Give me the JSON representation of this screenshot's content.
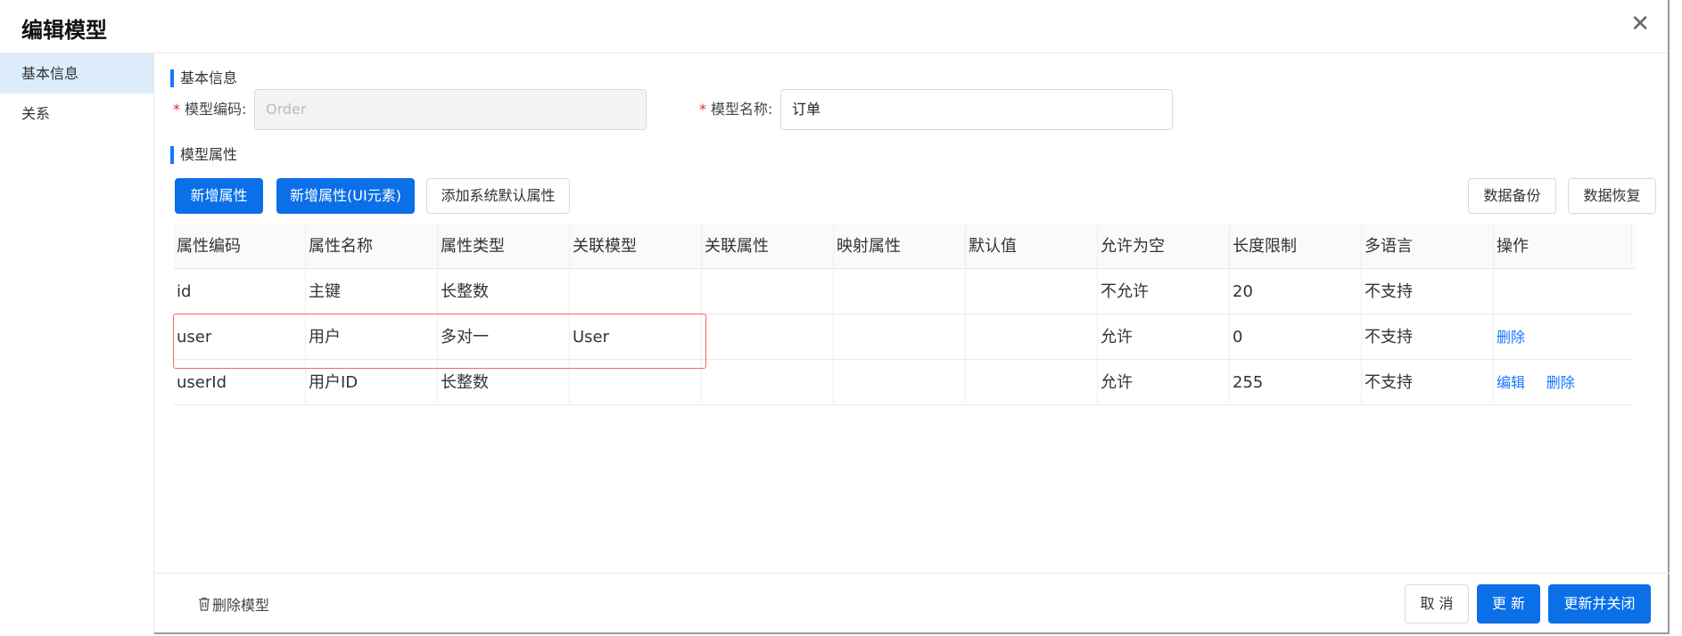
{
  "dialog": {
    "title": "编辑模型"
  },
  "sidebar": {
    "items": [
      {
        "label": "基本信息"
      },
      {
        "label": "关系"
      }
    ]
  },
  "basic": {
    "section_title": "基本信息",
    "code": {
      "label": "模型编码:",
      "placeholder": "Order"
    },
    "name": {
      "label": "模型名称:",
      "value": "订单"
    }
  },
  "props": {
    "section_title": "模型属性",
    "buttons": {
      "add": "新增属性",
      "add_ui": "新增属性(UI元素)",
      "add_default": "添加系统默认属性",
      "backup": "数据备份",
      "restore": "数据恢复"
    },
    "columns": [
      "属性编码",
      "属性名称",
      "属性类型",
      "关联模型",
      "关联属性",
      "映射属性",
      "默认值",
      "允许为空",
      "长度限制",
      "多语言",
      "操作"
    ],
    "rows": [
      {
        "code": "id",
        "name": "主键",
        "type": "长整数",
        "rel_model": "",
        "rel_prop": "",
        "map_prop": "",
        "default": "",
        "nullable": "不允许",
        "length": "20",
        "i18n": "不支持",
        "actions": []
      },
      {
        "code": "user",
        "name": "用户",
        "type": "多对一",
        "rel_model": "User",
        "rel_prop": "",
        "map_prop": "",
        "default": "",
        "nullable": "允许",
        "length": "0",
        "i18n": "不支持",
        "actions": [
          "删除"
        ]
      },
      {
        "code": "userId",
        "name": "用户ID",
        "type": "长整数",
        "rel_model": "",
        "rel_prop": "",
        "map_prop": "",
        "default": "",
        "nullable": "允许",
        "length": "255",
        "i18n": "不支持",
        "actions": [
          "编辑",
          "删除"
        ]
      }
    ]
  },
  "footer": {
    "delete_model": "删除模型",
    "cancel": "取 消",
    "update": "更 新",
    "update_close": "更新并关闭"
  },
  "colors": {
    "primary": "#0b6fe8",
    "link": "#1677ff",
    "required": "#f5222d",
    "highlight_border": "#f26b6b"
  },
  "icons": {
    "close": "close-icon",
    "trash": "trash-icon"
  }
}
